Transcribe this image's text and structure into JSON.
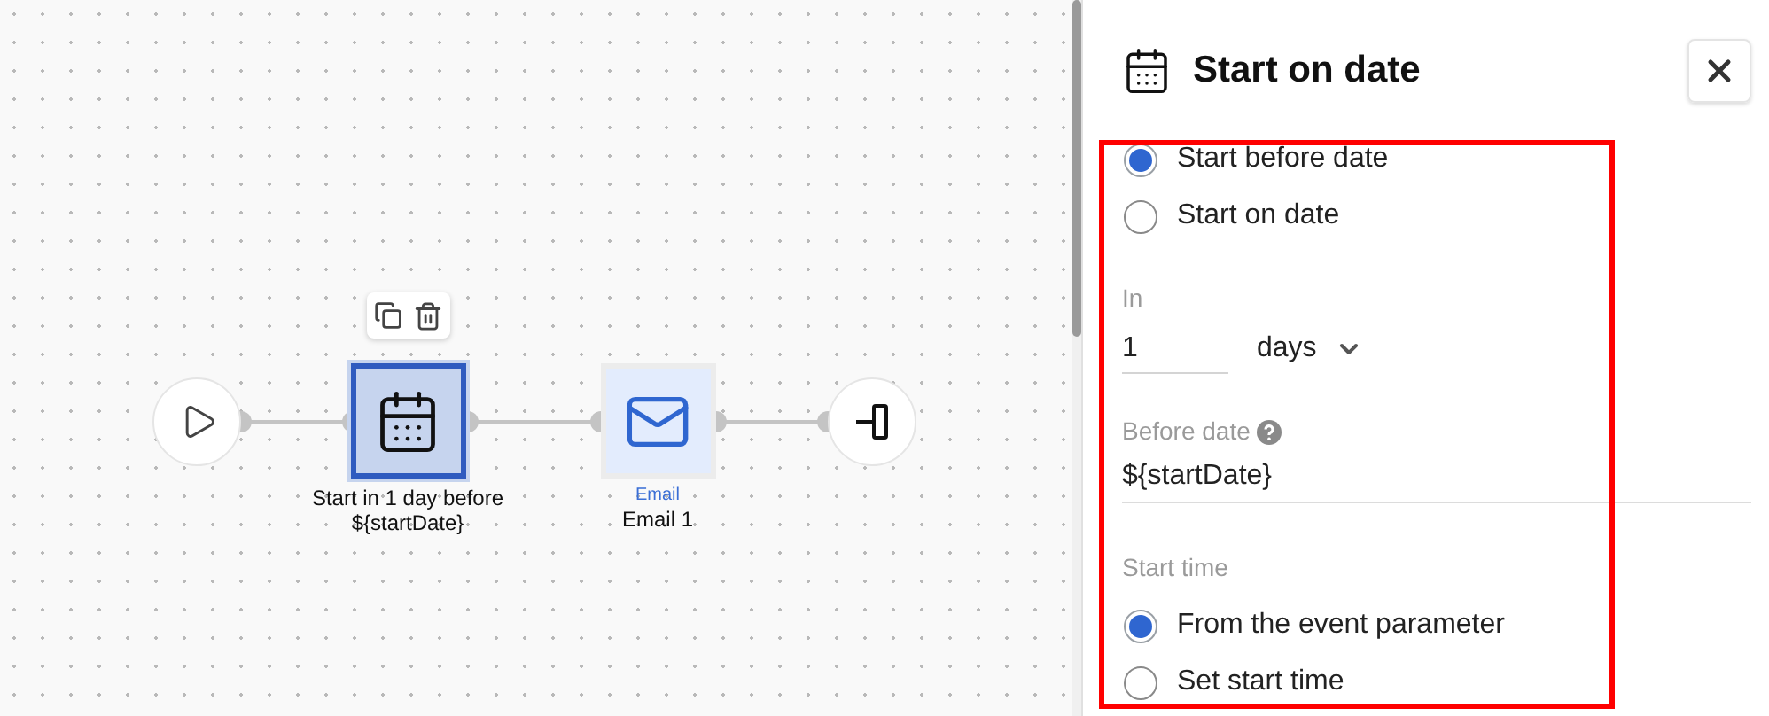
{
  "canvas": {
    "nodes": [
      {
        "kind": "start"
      },
      {
        "kind": "delay",
        "selected": true,
        "label": "Start in 1 day before ${startDate}"
      },
      {
        "kind": "email",
        "selected": false,
        "type_label": "Email",
        "label": "Email 1"
      },
      {
        "kind": "end"
      }
    ]
  },
  "panel": {
    "title": "Start on date",
    "mode_options": [
      {
        "label": "Start before date",
        "selected": true
      },
      {
        "label": "Start on date",
        "selected": false
      }
    ],
    "in_field": {
      "label": "In",
      "value": "1",
      "unit": "days"
    },
    "date_field": {
      "label": "Before date",
      "value": "${startDate}"
    },
    "start_time": {
      "label": "Start time",
      "options": [
        {
          "label": "From the event parameter",
          "selected": true
        },
        {
          "label": "Set start time",
          "selected": false
        }
      ]
    }
  },
  "highlight": {
    "on": true
  }
}
